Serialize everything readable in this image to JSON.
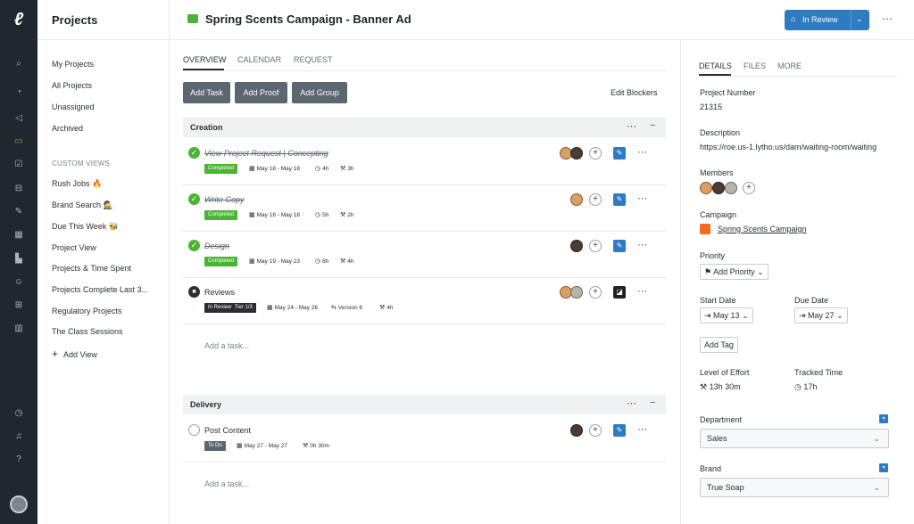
{
  "sidebar": {
    "title": "Projects",
    "nav": [
      "My Projects",
      "All Projects",
      "Unassigned",
      "Archived"
    ],
    "custom_views_label": "CUSTOM VIEWS",
    "views": [
      "Rush Jobs 🔥",
      "Brand Search 🕵",
      "Due This Week 🐝",
      "Project View",
      "Projects & Time Spent",
      "Projects Complete Last 3...",
      "Regulatory Projects",
      "The Class Sessions"
    ],
    "add_view": "Add View"
  },
  "header": {
    "title": "Spring Scents Campaign - Banner Ad",
    "status_button": "In Review"
  },
  "main": {
    "tabs": [
      "OVERVIEW",
      "CALENDAR",
      "REQUEST"
    ],
    "buttons": {
      "add_task": "Add Task",
      "add_proof": "Add Proof",
      "add_group": "Add Group"
    },
    "edit_blockers": "Edit Blockers",
    "groups": [
      {
        "title": "Creation"
      },
      {
        "title": "Delivery"
      }
    ],
    "tasks": [
      {
        "name": "View Project Request | Concepting",
        "status": "Completed",
        "dates": "May 18 - May 18",
        "time": "4h",
        "effort": "3h"
      },
      {
        "name": "Write Copy",
        "status": "Completed",
        "dates": "May 18 - May 18",
        "time": "5h",
        "effort": "2h"
      },
      {
        "name": "Design",
        "status": "Completed",
        "dates": "May 19 - May 23",
        "time": "8h",
        "effort": "4h"
      },
      {
        "name": "Reviews",
        "status": "In Review",
        "tier": "Tier 1/3",
        "dates": "May 24 - May 26",
        "version": "Version 6",
        "effort": "4h"
      },
      {
        "name": "Post Content",
        "status": "To Do",
        "dates": "May 27 - May 27",
        "effort": "0h 30m"
      }
    ],
    "add_task_placeholder": "Add a task..."
  },
  "details": {
    "tabs": [
      "DETAILS",
      "FILES",
      "MORE"
    ],
    "project_number_label": "Project Number",
    "project_number": "21315",
    "description_label": "Description",
    "description": "https://roe.us-1.lytho.us/dam/waiting-room/waiting",
    "members_label": "Members",
    "campaign_label": "Campaign",
    "campaign": "Spring Scents Campaign",
    "priority_label": "Priority",
    "priority": "Add Priority",
    "start_date_label": "Start Date",
    "start_date": "May 13",
    "due_date_label": "Due Date",
    "due_date": "May 27",
    "add_tag": "Add Tag",
    "effort_label": "Level of Effort",
    "effort": "13h 30m",
    "tracked_label": "Tracked Time",
    "tracked": "17h",
    "department_label": "Department",
    "department": "Sales",
    "brand_label": "Brand",
    "brand": "True Soap"
  }
}
